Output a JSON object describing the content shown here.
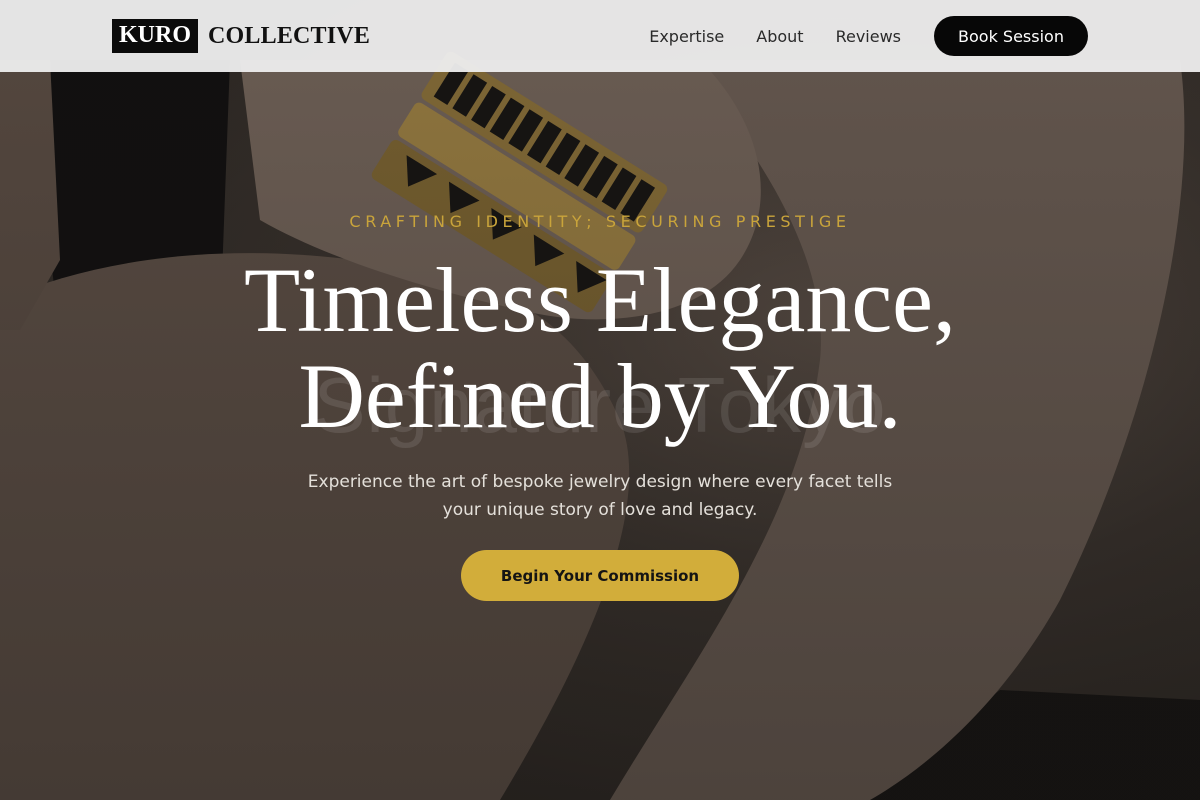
{
  "brand": {
    "logo_mark": "KURO",
    "logo_name": "COLLECTIVE"
  },
  "nav": {
    "links": [
      "Expertise",
      "About",
      "Reviews"
    ],
    "book_label": "Book Session"
  },
  "hero": {
    "tagline": "CRAFTING IDENTITY; SECURING PRESTIGE",
    "headline_line1": "Timeless Elegance,",
    "headline_line2": "Defined by You.",
    "watermark": "Signature Tokyo",
    "subtext": "Experience the art of bespoke jewelry design where every facet tells your unique story of love and legacy.",
    "cta_label": "Begin Your Commission"
  },
  "colors": {
    "accent_gold": "#d2ad3a",
    "tagline_gold": "#c9a43b",
    "nav_bg": "#ececec",
    "button_dark": "#070707"
  }
}
